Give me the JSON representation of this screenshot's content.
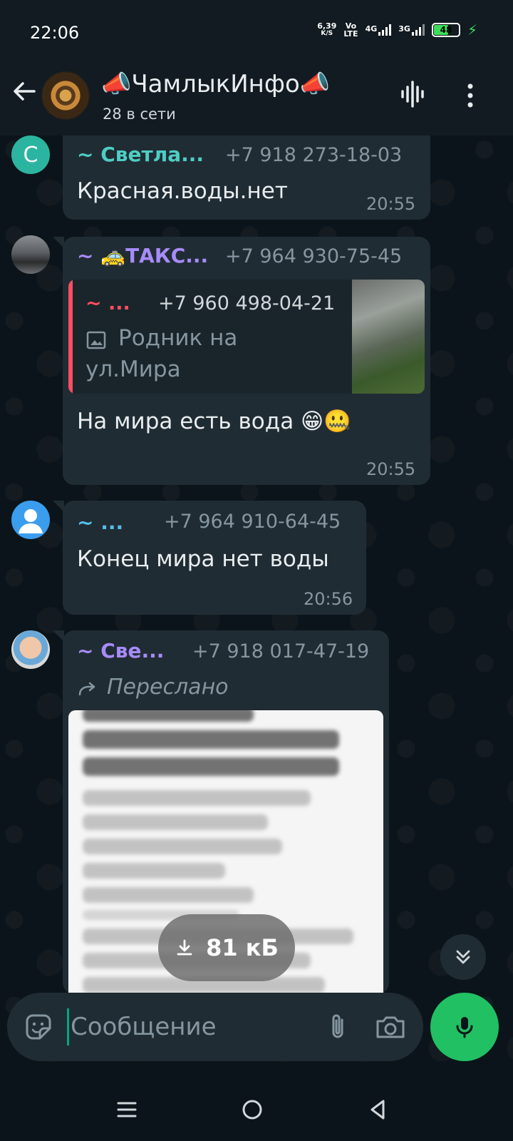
{
  "status_bar": {
    "time": "22:06",
    "speed_value": "6,39",
    "speed_unit": "K/S",
    "volte_top": "Vo",
    "volte_bottom": "LTE",
    "net1": "4G",
    "net2": "3G",
    "battery": "48"
  },
  "header": {
    "title": "📣ЧамлыкИнфо📣",
    "subtitle": "28 в сети"
  },
  "messages": [
    {
      "avatar_letter": "С",
      "sender": "~ Светла...",
      "phone": "+7 918 273-18-03",
      "text": "Красная.воды.нет",
      "time": "20:55"
    },
    {
      "sender": "~ 🚕ТАКС...",
      "phone": "+7 964 930-75-45",
      "quote_sender": "~ ...",
      "quote_phone": "+7 960 498-04-21",
      "quote_text_1": "Родник на",
      "quote_text_2": "ул.Мира",
      "text": "На мира есть вода 😁🤐",
      "time": "20:55"
    },
    {
      "sender": "~ ...",
      "phone": "+7 964 910-64-45",
      "text": "Конец мира нет воды",
      "time": "20:56"
    },
    {
      "sender": "~ Све...",
      "phone": "+7 918 017-47-19",
      "forwarded": "Переслано"
    }
  ],
  "download": {
    "size": "81 кБ"
  },
  "composer": {
    "placeholder": "Сообщение"
  },
  "colors": {
    "accent_green": "#21c063",
    "sender_teal": "#53bdeb",
    "sender_purple": "#a78bfa",
    "quote_red": "#ff4d62"
  }
}
